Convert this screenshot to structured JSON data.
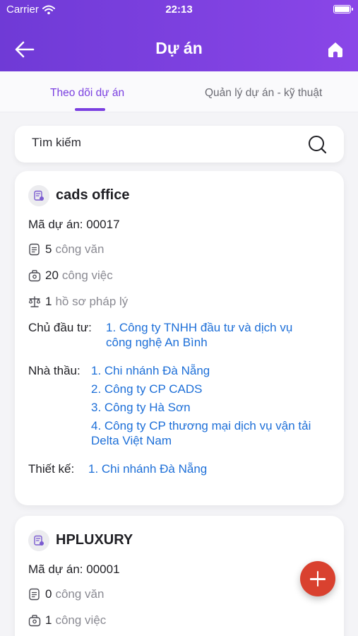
{
  "status_bar": {
    "carrier": "Carrier",
    "time": "22:13"
  },
  "header": {
    "title": "Dự án"
  },
  "tabs": [
    {
      "label": "Theo dõi dự án",
      "active": true
    },
    {
      "label": "Quản lý dự án - kỹ thuật",
      "active": false
    }
  ],
  "search": {
    "placeholder": "Tìm kiếm"
  },
  "projects": [
    {
      "name": "cads office",
      "code_label": "Mã dự án: 00017",
      "documents": {
        "count": "5",
        "label": "công văn"
      },
      "tasks": {
        "count": "20",
        "label": "công việc"
      },
      "legal": {
        "count": "1",
        "label": "hồ sơ pháp lý"
      },
      "investor_label": "Chủ đầu tư:",
      "investors": [
        "1. Công ty TNHH đầu tư và dịch vụ công nghệ An Bình"
      ],
      "contractor_label": "Nhà thầu:",
      "contractors": [
        "1. Chi nhánh Đà Nẵng",
        "2. Công ty CP CADS",
        "3. Công ty Hà Sơn",
        "4. Công ty CP thương mại dịch vụ vận tải Delta Việt Nam"
      ],
      "design_label": "Thiết kế:",
      "designers": [
        "1. Chi nhánh Đà Nẵng"
      ]
    },
    {
      "name": "HPLUXURY",
      "code_label": "Mã dự án: 00001",
      "documents": {
        "count": "0",
        "label": "công văn"
      },
      "tasks": {
        "count": "1",
        "label": "công việc"
      }
    }
  ],
  "colors": {
    "header": "#7a3fe0",
    "accent": "#7a3fe0",
    "link": "#1d6fd8",
    "fab": "#d9412f"
  },
  "icons": [
    "back-arrow-icon",
    "home-icon",
    "search-icon",
    "project-icon",
    "document-icon",
    "task-icon",
    "scale-icon",
    "plus-icon",
    "wifi-icon",
    "battery-icon"
  ]
}
